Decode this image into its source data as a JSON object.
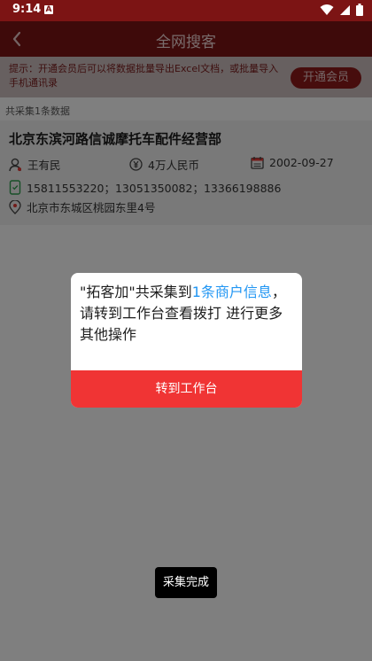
{
  "status_bar": {
    "time": "9:14",
    "notif_letter": "A"
  },
  "header": {
    "title": "全网搜客"
  },
  "promo": {
    "text": "提示：开通会员后可以将数据批量导出Excel文档，或批量导入手机通讯录",
    "button": "开通会员"
  },
  "results": {
    "count_text": "共采集1条数据"
  },
  "card": {
    "company": "北京东滨河路信诚摩托车配件经营部",
    "person": "王有民",
    "capital": "4万人民币",
    "date": "2002-09-27",
    "phones": "15811553220；13051350082；13366198886",
    "address": "北京市东城区桃园东里4号"
  },
  "dialog": {
    "text_prefix": "\"拓客加\"共采集到",
    "link_text": "1条商户信息",
    "text_suffix": "，请转到工作台查看拨打 进行更多其他操作",
    "button": "转到工作台"
  },
  "toast": {
    "text": "采集完成"
  },
  "colors": {
    "header": "#7c1414",
    "accent": "#f03434",
    "link": "#2196f3"
  }
}
